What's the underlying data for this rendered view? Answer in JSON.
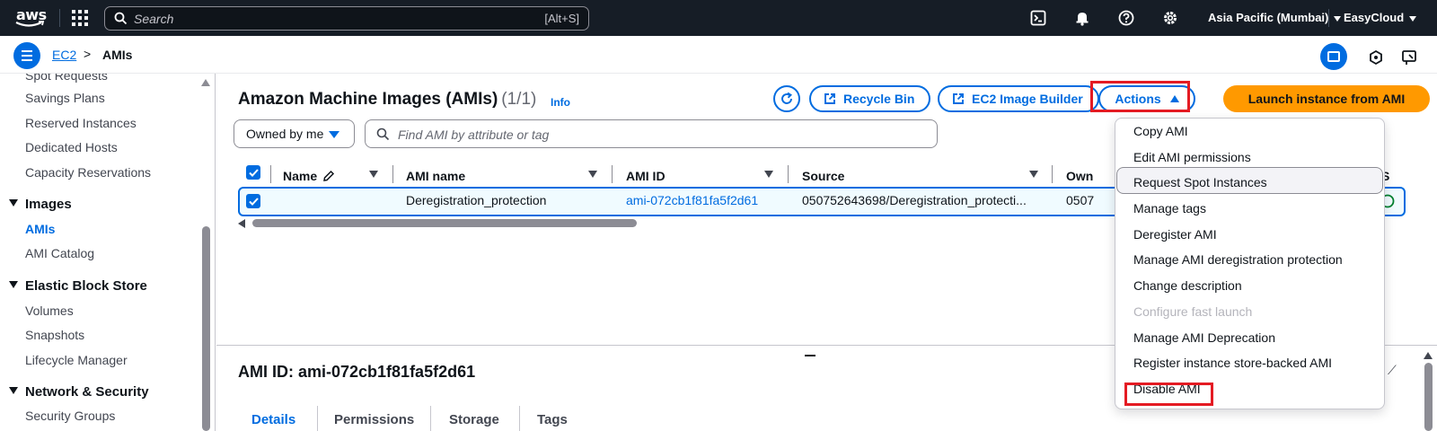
{
  "topnav": {
    "logo_text": "aws",
    "search_placeholder": "Search",
    "search_shortcut": "[Alt+S]",
    "region": "Asia Pacific (Mumbai)",
    "account": "EasyCloud"
  },
  "breadcrumb": {
    "parent": "EC2",
    "current": "AMIs"
  },
  "sidebar": {
    "items_top": [
      "Spot Requests",
      "Savings Plans",
      "Reserved Instances",
      "Dedicated Hosts",
      "Capacity Reservations"
    ],
    "sections": [
      {
        "label": "Images",
        "items": [
          "AMIs",
          "AMI Catalog"
        ]
      },
      {
        "label": "Elastic Block Store",
        "items": [
          "Volumes",
          "Snapshots",
          "Lifecycle Manager"
        ]
      },
      {
        "label": "Network & Security",
        "items": [
          "Security Groups"
        ]
      }
    ],
    "active": "AMIs"
  },
  "main": {
    "title": "Amazon Machine Images (AMIs)",
    "count": "(1/1)",
    "info": "Info",
    "buttons": {
      "recycle_bin": "Recycle Bin",
      "image_builder": "EC2 Image Builder",
      "actions": "Actions",
      "launch": "Launch instance from AMI"
    },
    "filter": {
      "owner": "Owned by me",
      "search_placeholder": "Find AMI by attribute or tag"
    },
    "table": {
      "columns": [
        "Name",
        "AMI name",
        "AMI ID",
        "Source",
        "Own",
        "S"
      ],
      "rows": [
        {
          "name": "",
          "ami_name": "Deregistration_protection",
          "ami_id": "ami-072cb1f81fa5f2d61",
          "source": "050752643698/Deregistration_protecti...",
          "owner": "0507"
        }
      ]
    }
  },
  "actions_menu": {
    "items": [
      {
        "label": "Copy AMI",
        "disabled": false
      },
      {
        "label": "Edit AMI permissions",
        "disabled": false
      },
      {
        "label": "Request Spot Instances",
        "disabled": false
      },
      {
        "label": "Manage tags",
        "disabled": false
      },
      {
        "label": "Deregister AMI",
        "disabled": false
      },
      {
        "label": "Manage AMI deregistration protection",
        "disabled": false
      },
      {
        "label": "Change description",
        "disabled": false
      },
      {
        "label": "Configure fast launch",
        "disabled": true
      },
      {
        "label": "Manage AMI Deprecation",
        "disabled": false
      },
      {
        "label": "Register instance store-backed AMI",
        "disabled": false
      },
      {
        "label": "Disable AMI",
        "disabled": false
      }
    ],
    "hovered": "Request Spot Instances"
  },
  "details": {
    "title": "AMI ID: ami-072cb1f81fa5f2d61",
    "tabs": [
      "Details",
      "Permissions",
      "Storage",
      "Tags"
    ],
    "active_tab": "Details"
  },
  "colors": {
    "nav_bg": "#161d26",
    "accent": "#006ce0",
    "primary": "#ff9900",
    "highlight": "#e41b23"
  }
}
